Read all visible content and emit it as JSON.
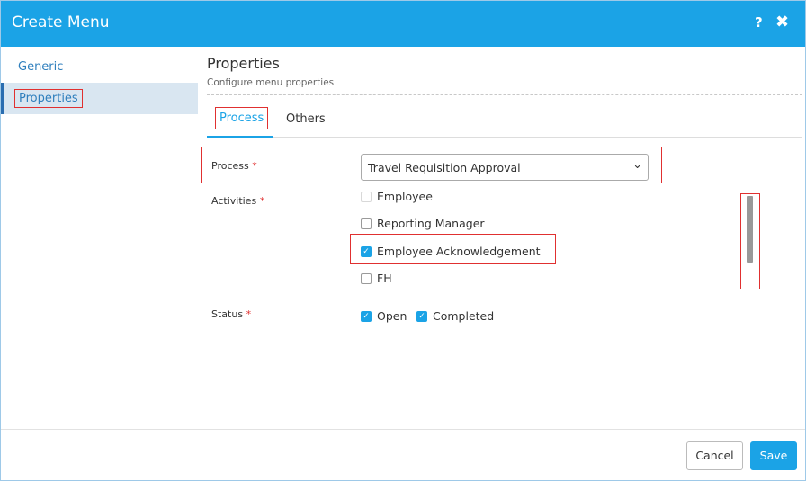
{
  "dialog": {
    "title": "Create Menu",
    "help_icon": "question-mark-icon",
    "close_icon": "close-x-icon"
  },
  "sidebar": {
    "items": [
      {
        "label": "Generic"
      },
      {
        "label": "Properties",
        "selected": true
      }
    ]
  },
  "properties": {
    "title": "Properties",
    "subtitle": "Configure menu properties"
  },
  "tabs": [
    {
      "label": "Process",
      "active": true
    },
    {
      "label": "Others"
    }
  ],
  "form": {
    "process_label": "Process",
    "activities_label": "Activities",
    "status_label": "Status",
    "required_mark": "*",
    "process_value": "Travel Requisition Approval",
    "activities": [
      {
        "label": "Employee",
        "checked": false,
        "disabled": true
      },
      {
        "label": "Reporting Manager",
        "checked": false
      },
      {
        "label": "Employee Acknowledgement",
        "checked": true
      },
      {
        "label": "FH",
        "checked": false
      }
    ],
    "status_options": [
      {
        "label": "Open",
        "checked": true
      },
      {
        "label": "Completed",
        "checked": true
      }
    ]
  },
  "footer": {
    "cancel_label": "Cancel",
    "save_label": "Save"
  },
  "colors": {
    "accent": "#1ba3e6",
    "highlight": "#e03030",
    "selected_bg": "#d9e6f1"
  }
}
